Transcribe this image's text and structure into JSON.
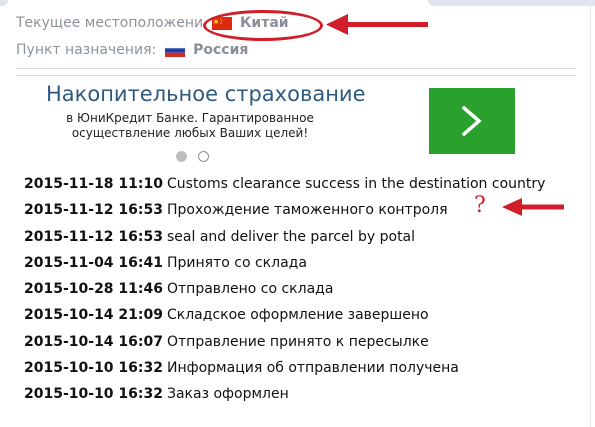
{
  "location": {
    "current_label": "Текущее местоположени",
    "current_value": "Китай",
    "destination_label": "Пункт назначения:",
    "destination_value": "Россия"
  },
  "ad": {
    "title": "Накопительное страхование",
    "description": "в ЮниКредит Банке. Гарантированное осуществление любых Ваших целей!",
    "button_icon": "chevron-right-icon",
    "button_color": "#2aa12d",
    "slide_count": 2,
    "active_slide": 1
  },
  "annotations": {
    "question_mark": "?",
    "marker_color": "#d01f2a"
  },
  "events": [
    {
      "timestamp": "2015-11-18 11:10",
      "status": "Customs clearance success in the destination country"
    },
    {
      "timestamp": "2015-11-12 16:53",
      "status": "Прохождение таможенного контроля"
    },
    {
      "timestamp": "2015-11-12 16:53",
      "status": "seal and deliver the parcel by potal"
    },
    {
      "timestamp": "2015-11-04 16:41",
      "status": "Принято со склада"
    },
    {
      "timestamp": "2015-10-28 11:46",
      "status": "Отправлено со склада"
    },
    {
      "timestamp": "2015-10-14 21:09",
      "status": "Складское оформление завершено"
    },
    {
      "timestamp": "2015-10-14 16:07",
      "status": "Отправление принято к пересылке"
    },
    {
      "timestamp": "2015-10-10 16:32",
      "status": "Информация об отправлении получена"
    },
    {
      "timestamp": "2015-10-10 16:32",
      "status": "Заказ оформлен"
    }
  ]
}
